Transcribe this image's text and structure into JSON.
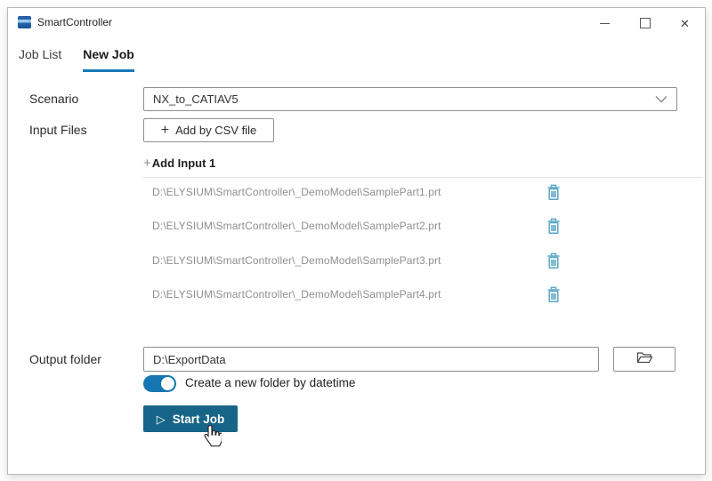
{
  "window": {
    "title": "SmartController"
  },
  "icons": {
    "close": "✕",
    "start_play": "▷",
    "plus": "+"
  },
  "tabs": [
    {
      "label": "Job List",
      "active": false
    },
    {
      "label": "New Job",
      "active": true
    }
  ],
  "form": {
    "scenario": {
      "label": "Scenario",
      "value": "NX_to_CATIAV5"
    },
    "input_files": {
      "label": "Input Files",
      "add_csv_button": "Add by CSV file",
      "add_input_label": "Add Input 1",
      "files": [
        "D:\\ELYSIUM\\SmartController\\_DemoModel\\SamplePart1.prt",
        "D:\\ELYSIUM\\SmartController\\_DemoModel\\SamplePart2.prt",
        "D:\\ELYSIUM\\SmartController\\_DemoModel\\SamplePart3.prt",
        "D:\\ELYSIUM\\SmartController\\_DemoModel\\SamplePart4.prt"
      ]
    },
    "output": {
      "label": "Output folder",
      "path": "D:\\ExportData",
      "toggle_label": "Create a new folder by datetime",
      "toggle_on": true
    },
    "start_button": "Start Job"
  },
  "colors": {
    "tab_underline": "#1779ba",
    "toggle_on": "#1476b2",
    "start_button": "#166487",
    "trash_icon": "#58a6c6"
  }
}
